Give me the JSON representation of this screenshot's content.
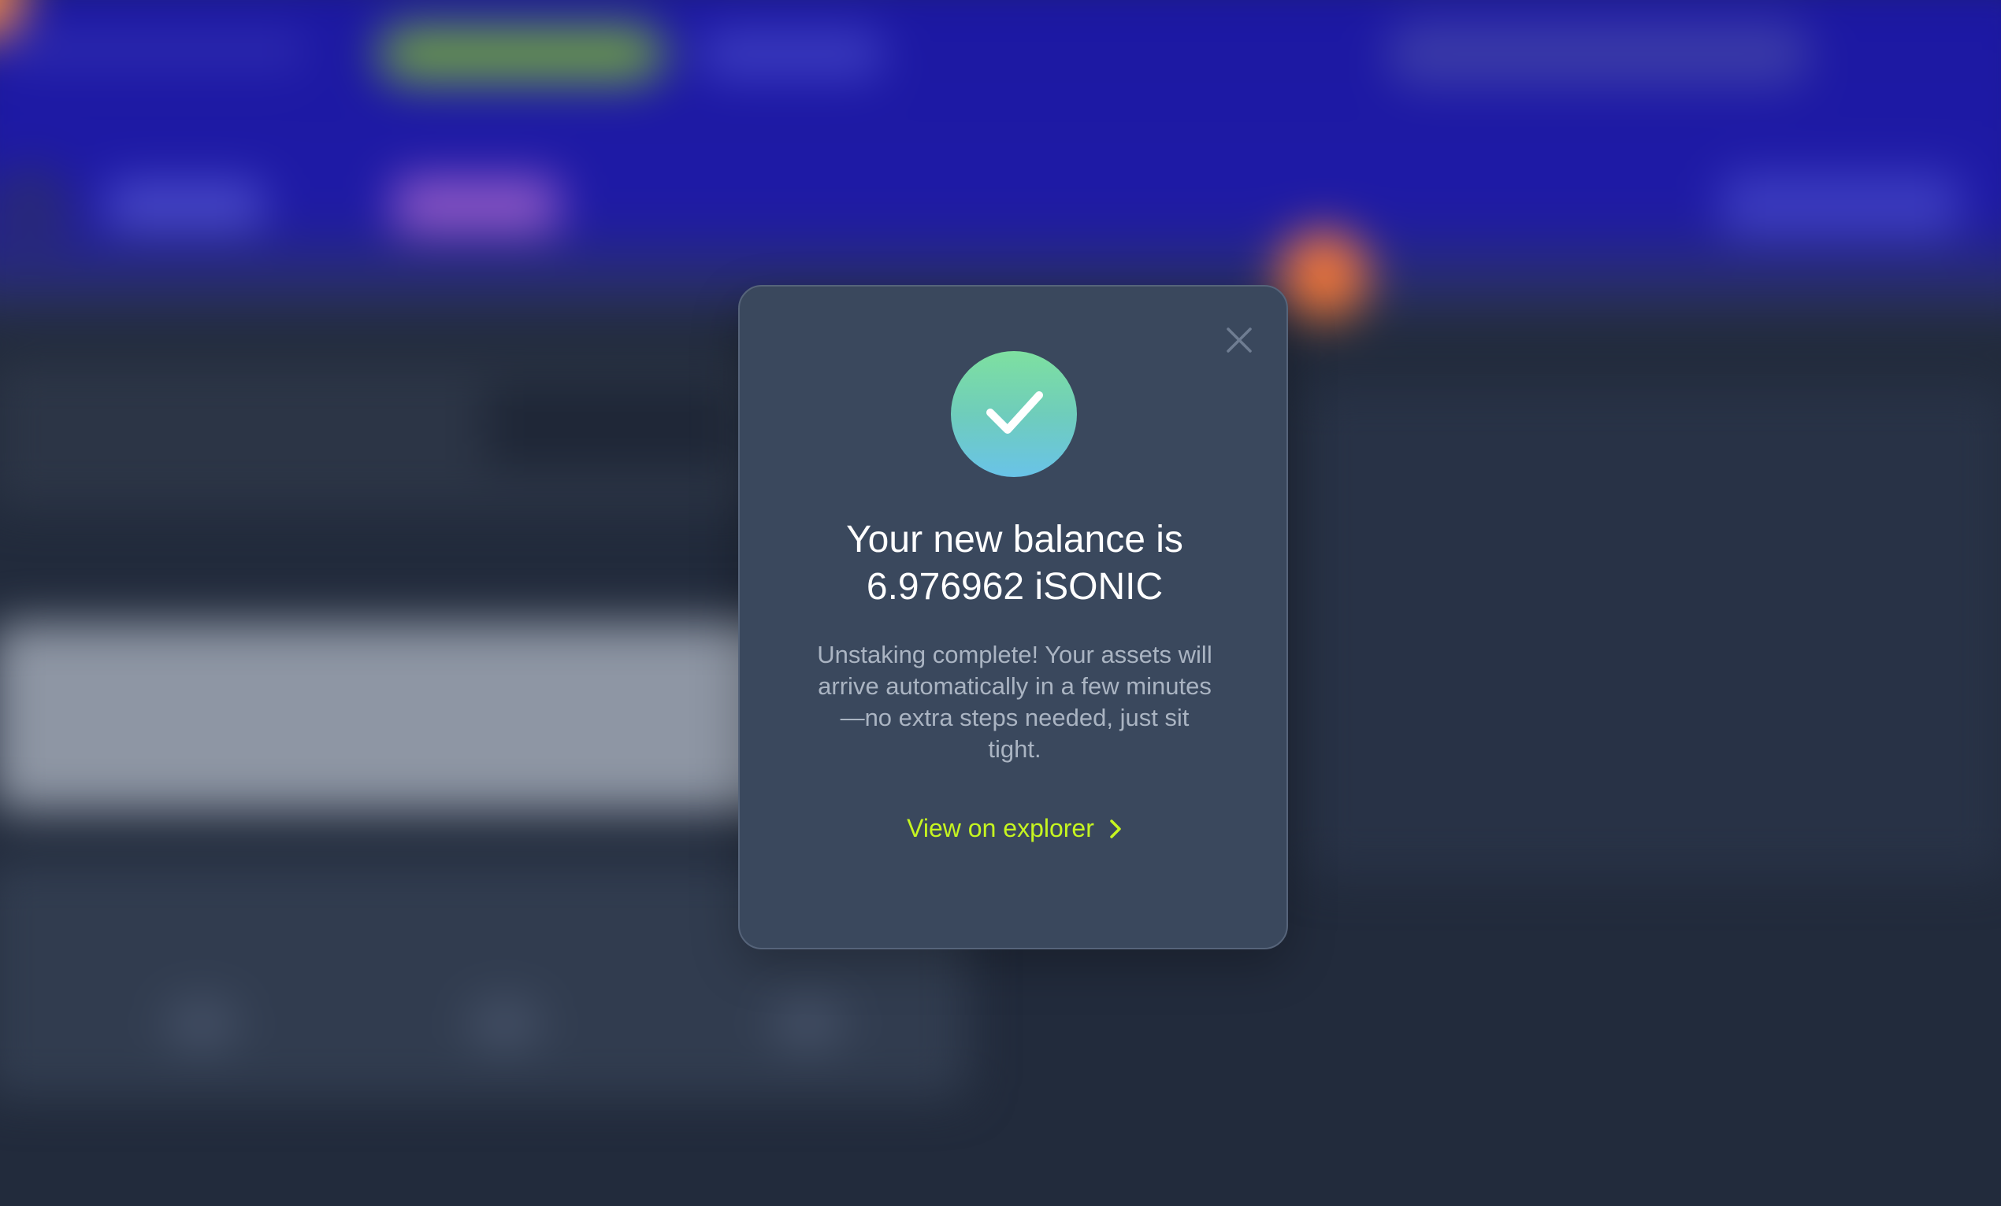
{
  "modal": {
    "close_label": "close",
    "title_line1": "Your new balance is",
    "title_line2": "6.976962 iSONIC",
    "description": "Unstaking complete! Your assets will arrive automatically in a few minutes—no extra steps needed, just sit tight.",
    "explorer_link": "View on explorer"
  },
  "icons": {
    "close": "close-icon",
    "success": "checkmark-icon",
    "explorer": "chevron-right-icon"
  },
  "colors": {
    "accent": "#c6f520",
    "modal_bg": "#3a485d",
    "header_bg": "#1c18a2",
    "page_bg": "#222b3c"
  }
}
